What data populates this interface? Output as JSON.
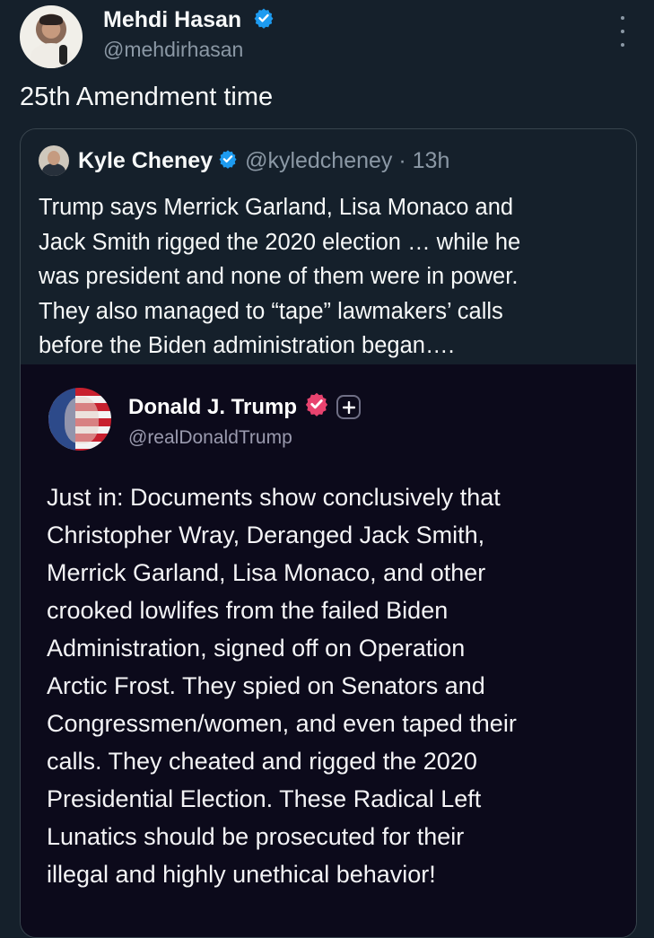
{
  "tweet": {
    "author_name": "Mehdi Hasan",
    "author_handle": "@mehdirhasan",
    "text": "25th Amendment time",
    "verified_color": "#1d9bf0"
  },
  "quote": {
    "author_name": "Kyle Cheney",
    "author_handle": "@kyledcheney · 13h",
    "lines": [
      "Trump says Merrick Garland, Lisa Monaco and",
      "Jack Smith rigged the 2020 election … while he",
      "was president and none of them were in power.",
      "They also managed to “tape” lawmakers’ calls",
      "before the Biden administration began…."
    ]
  },
  "embed": {
    "author_name": "Donald J. Trump",
    "author_handle": "@realDonaldTrump",
    "badge_color": "#e8436f",
    "lines": [
      "Just in: Documents show conclusively that",
      "Christopher Wray, Deranged Jack Smith,",
      "Merrick Garland, Lisa Monaco, and other",
      "crooked lowlifes from the failed Biden",
      "Administration, signed off on Operation",
      "Arctic Frost. They spied on Senators and",
      "Congressmen/women, and even taped their",
      "calls. They cheated and rigged the 2020",
      "Presidential Election. These Radical Left",
      "Lunatics should be prosecuted for their",
      "illegal and highly unethical behavior!"
    ]
  },
  "icons": {
    "verified": "verified-badge-icon",
    "more": "more-options-icon",
    "plus": "plus-icon"
  }
}
